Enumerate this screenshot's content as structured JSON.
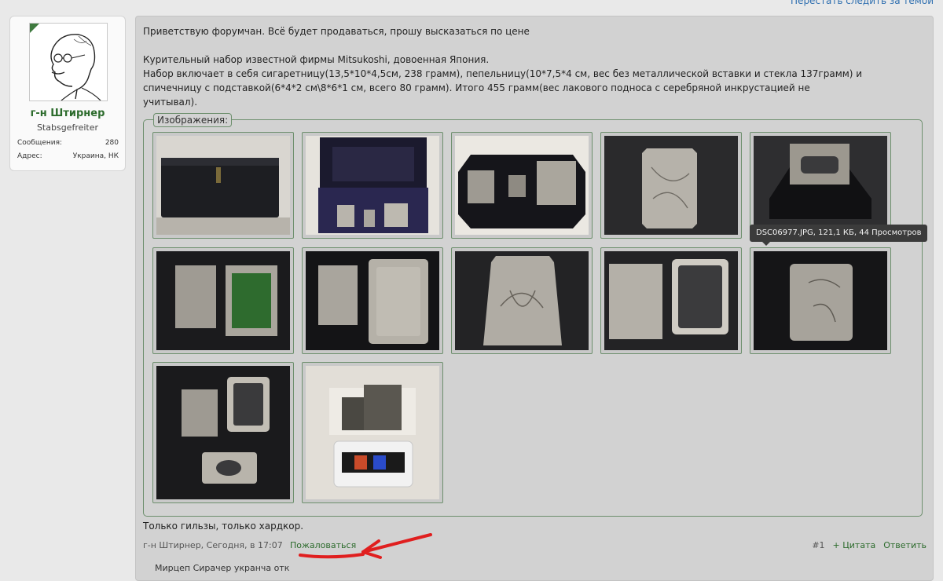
{
  "page": {
    "top_link": "Перестать следить за темой"
  },
  "user": {
    "name": "г-н Штирнер",
    "title": "Stabsgefreiter",
    "stats": [
      {
        "label": "Сообщения:",
        "value": "280"
      },
      {
        "label": "Адрес:",
        "value": "Украина, НК"
      }
    ]
  },
  "post": {
    "greeting": "Приветствую форумчан. Всё будет продаваться, прошу высказаться по цене",
    "line1": "Курительный набор известной фирмы Mitsukoshi, довоенная Япония.",
    "line2": "Набор включает в себя сигаретницу(13,5*10*4,5см, 238 грамм), пепельницу(10*7,5*4 см, вес без металлической вставки и стекла 137грамм) и",
    "line3": "спичечницу с подставкой(6*4*2 см\\8*6*1 см, всего 80 грамм). Итого 455 грамм(вес лакового подноса с серебряной инкрустацией не",
    "line4": "учитывал).",
    "attachments_label": "Изображения:",
    "tooltip": "DSC06977.JPG, 121,1 КБ, 44 Просмотров",
    "signature": "Только гильзы, только хардкор.",
    "meta": "г-н Штирнер, Сегодня, в 17:07",
    "report": "Пожаловаться",
    "post_number": "#1",
    "quote": "+ Цитата",
    "reply": "Ответить",
    "next_text": "Мирцеп Сирачер укранча отк"
  },
  "colors": {
    "link_green": "#2c6b2c",
    "panel": "#d2d2d2",
    "accent_red": "#e01f1f"
  }
}
